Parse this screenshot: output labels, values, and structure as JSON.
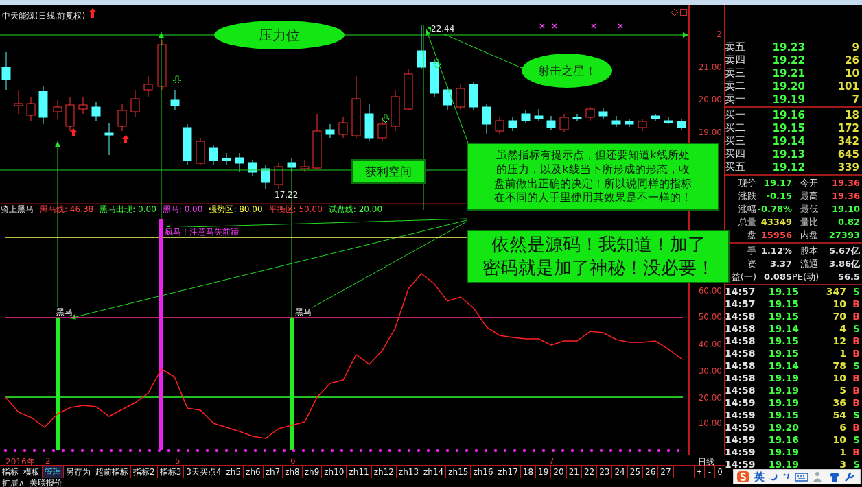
{
  "title": "中天能源(日线.前复权)",
  "price_axis": [
    "2",
    "21.00",
    "20.00",
    "19.00"
  ],
  "price_marks": {
    "high": "22.44",
    "low": "17.22"
  },
  "annotations": [
    {
      "kind": "ellipse",
      "text": "压力位"
    },
    {
      "kind": "ellipse",
      "text": "射击之星！"
    },
    {
      "kind": "box",
      "text": "获利空间"
    },
    {
      "kind": "note",
      "lines": [
        "虽然指标有提示点，但还要知道k线所处",
        "的压力，以及k线当下所形成的形态，收",
        "盘前做出正确的决定！所以说同样的指标",
        "在不同的人手里使用其效果是不一样的！"
      ]
    },
    {
      "kind": "big",
      "lines": [
        "依然是源码！我知道！加了",
        "密码就是加了神秘！没必要！"
      ]
    }
  ],
  "indicator": {
    "name": "骑上黑马",
    "values": [
      {
        "label": "黑马线: 46.38",
        "color": "#ff4040"
      },
      {
        "label": "黑马出现: 0.00",
        "color": "#40ff40"
      },
      {
        "label": "黑马: 0.00",
        "color": "#ff40ff"
      },
      {
        "label": "强势区: 80.00",
        "color": "#ffff40"
      },
      {
        "label": "平衡区: 50.00",
        "color": "#ff4040"
      },
      {
        "label": "试盘线: 20.00",
        "color": "#40ff40"
      }
    ]
  },
  "indicator_axis": [
    "60.00",
    "50.00",
    "40.00",
    "30.00",
    "20.00",
    "10.00"
  ],
  "signals": [
    {
      "text": "黑马",
      "kind": "black"
    },
    {
      "text": "疯马！注意马失前蹄",
      "kind": "crazy"
    },
    {
      "text": "黑马",
      "kind": "black"
    }
  ],
  "date_axis": {
    "year": "2016年",
    "months": [
      "2",
      "5",
      "6",
      "7"
    ],
    "period": "日线"
  },
  "tabs": [
    {
      "label": "指标",
      "selected": false
    },
    {
      "label": "模板",
      "selected": false
    },
    {
      "label": "管理",
      "selected": true
    },
    {
      "label": "另存为",
      "selected": false
    },
    {
      "label": "超前指标",
      "selected": false
    },
    {
      "label": "指标2",
      "selected": false
    },
    {
      "label": "指标3",
      "selected": false
    },
    {
      "label": "3天买点4",
      "selected": false
    },
    {
      "label": "zh5",
      "selected": false
    },
    {
      "label": "zh6",
      "selected": false
    },
    {
      "label": "zh7",
      "selected": false
    },
    {
      "label": "zh8",
      "selected": false
    },
    {
      "label": "zh9",
      "selected": false
    },
    {
      "label": "zh10",
      "selected": false
    },
    {
      "label": "zh11",
      "selected": false
    },
    {
      "label": "zh12",
      "selected": false
    },
    {
      "label": "zh13",
      "selected": false
    },
    {
      "label": "zh14",
      "selected": false
    },
    {
      "label": "zh15",
      "selected": false
    },
    {
      "label": "zh16",
      "selected": false
    },
    {
      "label": "zh17",
      "selected": false
    },
    {
      "label": "18",
      "selected": false
    },
    {
      "label": "19",
      "selected": false
    },
    {
      "label": "20",
      "selected": false
    },
    {
      "label": "21",
      "selected": false
    },
    {
      "label": "22",
      "selected": false
    },
    {
      "label": "23",
      "selected": false
    },
    {
      "label": "24",
      "selected": false
    },
    {
      "label": "25",
      "selected": false
    },
    {
      "label": "26",
      "selected": false
    },
    {
      "label": "27",
      "selected": false
    }
  ],
  "zoom_buttons": [
    "+",
    "-",
    "0"
  ],
  "bottom_tabs": [
    "扩展∧",
    "关联报价"
  ],
  "asks": [
    {
      "label": "卖五",
      "price": "19.23",
      "volume": "9"
    },
    {
      "label": "卖四",
      "price": "19.22",
      "volume": "26"
    },
    {
      "label": "卖三",
      "price": "19.21",
      "volume": "10"
    },
    {
      "label": "卖二",
      "price": "19.20",
      "volume": "101"
    },
    {
      "label": "卖一",
      "price": "19.19",
      "volume": "7"
    }
  ],
  "bids": [
    {
      "label": "买一",
      "price": "19.16",
      "volume": "18"
    },
    {
      "label": "买二",
      "price": "19.15",
      "volume": "172"
    },
    {
      "label": "买三",
      "price": "19.14",
      "volume": "342"
    },
    {
      "label": "买四",
      "price": "19.13",
      "volume": "645"
    },
    {
      "label": "买五",
      "price": "19.12",
      "volume": "339"
    }
  ],
  "quote": [
    [
      {
        "label": "现价",
        "value": "19.17",
        "color": "#40ff40"
      },
      {
        "label": "今开",
        "value": "19.36",
        "color": "#ff4848"
      }
    ],
    [
      {
        "label": "涨跌",
        "value": "-0.15",
        "color": "#40ff40"
      },
      {
        "label": "最高",
        "value": "19.36",
        "color": "#ff4848"
      }
    ],
    [
      {
        "label": "涨幅",
        "value": "-0.78%",
        "color": "#40ff40"
      },
      {
        "label": "最低",
        "value": "19.10",
        "color": "#40ff40"
      }
    ],
    [
      {
        "label": "总量",
        "value": "43349",
        "color": "#e0e040"
      },
      {
        "label": "量比",
        "value": "0.82",
        "color": "#40ff40"
      }
    ],
    [
      {
        "label": "盘",
        "value": "15956",
        "color": "#ff4848"
      },
      {
        "label": "内盘",
        "value": "27393",
        "color": "#40ff40"
      }
    ]
  ],
  "fundamentals": [
    [
      {
        "label": "手",
        "value": "1.12%"
      },
      {
        "label": "股本",
        "value": "5.67亿"
      }
    ],
    [
      {
        "label": "资",
        "value": "3.37"
      },
      {
        "label": "流通",
        "value": "3.86亿"
      }
    ],
    [
      {
        "label": "益(一)",
        "value": "0.085"
      },
      {
        "label": "PE(动)",
        "value": "56.5"
      }
    ]
  ],
  "trades": [
    {
      "time": "14:57",
      "price": "19.15",
      "volume": "347",
      "side": "S",
      "color": "#40ff40"
    },
    {
      "time": "14:57",
      "price": "19.15",
      "volume": "10",
      "side": "B",
      "color": "#ff4848"
    },
    {
      "time": "14:58",
      "price": "19.15",
      "volume": "70",
      "side": "B",
      "color": "#ff4848"
    },
    {
      "time": "14:58",
      "price": "19.14",
      "volume": "4",
      "side": "S",
      "color": "#40ff40"
    },
    {
      "time": "14:58",
      "price": "19.15",
      "volume": "12",
      "side": "B",
      "color": "#ff4848"
    },
    {
      "time": "14:58",
      "price": "19.15",
      "volume": "1",
      "side": "B",
      "color": "#ff4848"
    },
    {
      "time": "14:58",
      "price": "19.14",
      "volume": "78",
      "side": "S",
      "color": "#40ff40"
    },
    {
      "time": "14:58",
      "price": "19.19",
      "volume": "10",
      "side": "B",
      "color": "#ff4848"
    },
    {
      "time": "14:58",
      "price": "19.19",
      "volume": "5",
      "side": "B",
      "color": "#ff4848"
    },
    {
      "time": "14:59",
      "price": "19.19",
      "volume": "36",
      "side": "B",
      "color": "#ff4848"
    },
    {
      "time": "14:59",
      "price": "19.15",
      "volume": "54",
      "side": "S",
      "color": "#40ff40"
    },
    {
      "time": "14:59",
      "price": "19.20",
      "volume": "6",
      "side": "B",
      "color": "#ff4848"
    },
    {
      "time": "14:59",
      "price": "19.16",
      "volume": "10",
      "side": "S",
      "color": "#40ff40"
    },
    {
      "time": "14:59",
      "price": "19.19",
      "volume": "1",
      "side": "B",
      "color": "#ff4848"
    },
    {
      "time": "14:59",
      "price": "19.19",
      "volume": "3",
      "side": "S",
      "color": "#40ff40"
    }
  ],
  "ime_bar": {
    "mode": "英"
  }
}
